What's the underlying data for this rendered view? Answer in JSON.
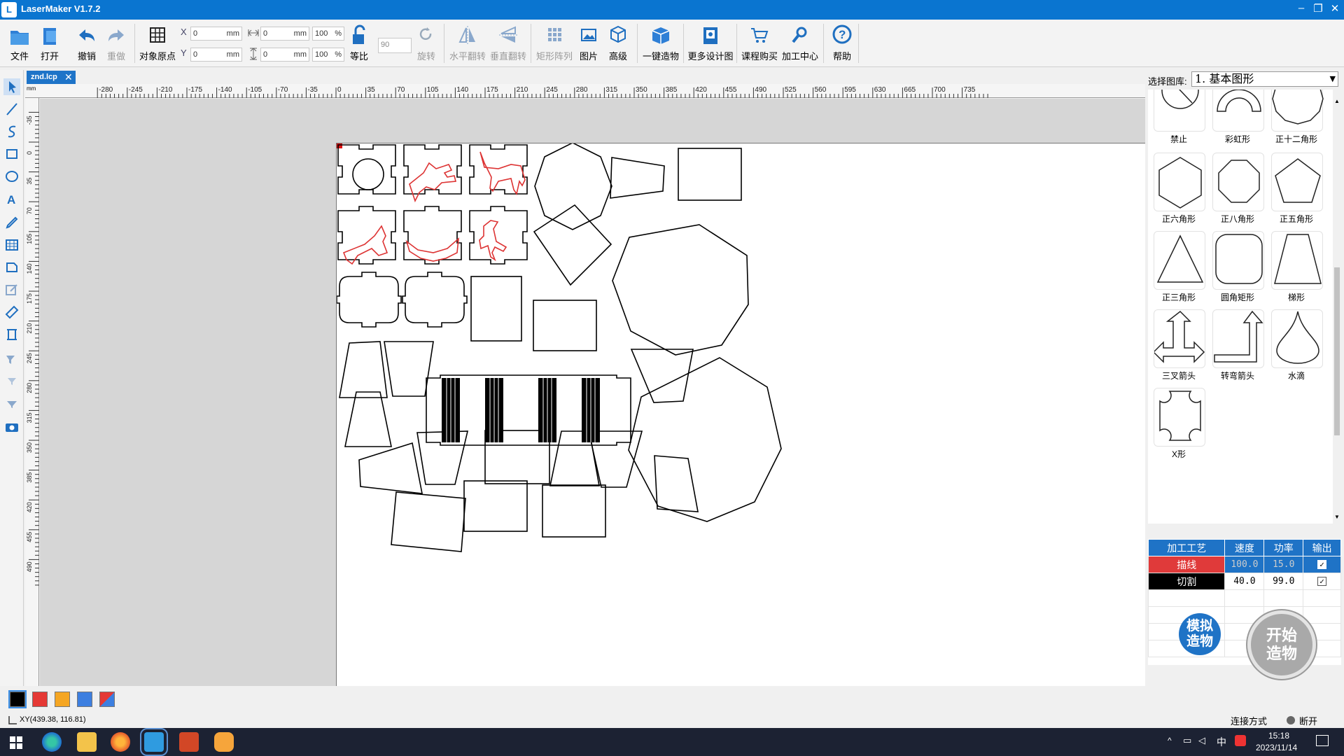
{
  "app": {
    "title": "LaserMaker V1.7.2",
    "logo_glyph": "L"
  },
  "window_controls": {
    "minimize": "–",
    "restore": "❐",
    "close": "✕"
  },
  "toolbar": {
    "file": "文件",
    "open": "打开",
    "undo": "撤销",
    "redo": "重做",
    "origin": "对象原点",
    "x_label": "X",
    "y_label": "Y",
    "x_value": "0",
    "y_value": "0",
    "w_value": "0",
    "h_value": "0",
    "unit": "mm",
    "w_scale": "100",
    "h_scale": "100",
    "pct": "%",
    "lock": "等比",
    "rotate_value": "90",
    "rotate": "旋转",
    "hflip": "水平翻转",
    "vflip": "垂直翻转",
    "array": "矩形阵列",
    "image": "图片",
    "advanced": "高级",
    "one_click": "一键造物",
    "more_designs": "更多设计图",
    "buy": "课程购买",
    "center": "加工中心",
    "help": "帮助"
  },
  "document_tab": {
    "name": "znd.lcp",
    "close": "✕"
  },
  "rulers": {
    "unit_label": "mm",
    "top_ticks": [
      "-280",
      "-245",
      "-210",
      "-175",
      "-140",
      "-105",
      "-70",
      "-35",
      "0",
      "35",
      "70",
      "105",
      "140",
      "175",
      "210",
      "245",
      "280",
      "315",
      "350",
      "385",
      "420",
      "455",
      "490",
      "525",
      "560",
      "595",
      "630",
      "665",
      "700",
      "735"
    ],
    "left_ticks": [
      "-35",
      "0",
      "35",
      "70",
      "105",
      "140",
      "175",
      "210",
      "245",
      "280",
      "315",
      "350",
      "385",
      "420",
      "455",
      "490"
    ]
  },
  "library": {
    "label": "选择图库:",
    "selected": "1. 基本图形",
    "items": [
      "禁止",
      "彩虹形",
      "正十二角形",
      "正六角形",
      "正八角形",
      "正五角形",
      "正三角形",
      "圆角矩形",
      "梯形",
      "三叉箭头",
      "转弯箭头",
      "水滴",
      "X形"
    ]
  },
  "process_table": {
    "headers": [
      "加工工艺",
      "速度",
      "功率",
      "输出"
    ],
    "rows": [
      {
        "name": "描线",
        "speed": "100.0",
        "power": "15.0",
        "color": "#e03a3a"
      },
      {
        "name": "切割",
        "speed": "40.0",
        "power": "99.0",
        "color": "#000000"
      }
    ]
  },
  "buttons": {
    "simulate": "模拟\n造物",
    "start": "开始\n造物"
  },
  "palette": {
    "colors": [
      "#000000",
      "#e53935",
      "#f5a623",
      "#3d7fe0",
      "multi"
    ]
  },
  "status": {
    "coords": "XY(439.38, 116.81)",
    "connection_label": "连接方式",
    "connection_state": "断开"
  },
  "taskbar": {
    "time": "15:18",
    "date": "2023/11/14",
    "ime": "中"
  },
  "colors": {
    "accent": "#1f73c6",
    "engrave": "#e03a3a",
    "cut": "#000000"
  }
}
